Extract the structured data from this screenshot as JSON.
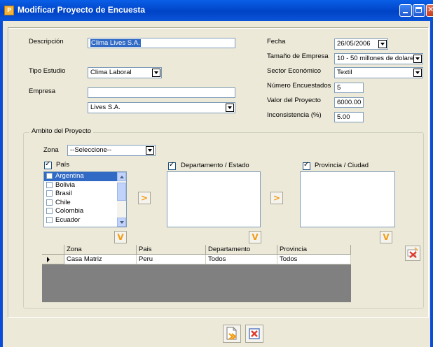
{
  "window": {
    "title": "Modificar Proyecto de Encuesta"
  },
  "form": {
    "descripcion_label": "Descripción",
    "descripcion_value": "Clima Lives S.A.",
    "tipo_estudio_label": "Tipo Estudio",
    "tipo_estudio_value": "Clima Laboral",
    "empresa_label": "Empresa",
    "empresa_search_value": "",
    "empresa_value": "Lives S.A.",
    "fecha_label": "Fecha",
    "fecha_value": "26/05/2006",
    "tamano_label": "Tamaño de Empresa",
    "tamano_value": "10 - 50 millones de dolare",
    "sector_label": "Sector Económico",
    "sector_value": "Textil",
    "num_encuestados_label": "Número Encuestados",
    "num_encuestados_value": "5",
    "valor_label": "Valor del Proyecto",
    "valor_value": "6000.00",
    "inconsistencia_label": "Inconsistencia (%)",
    "inconsistencia_value": "5.00"
  },
  "ambito": {
    "title": "Ambito del Proyecto",
    "zona_label": "Zona",
    "zona_value": "--Seleccione--",
    "pais_label": "País",
    "departamento_label": "Departamento / Estado",
    "provincia_label": "Provincia / Ciudad",
    "paises": [
      "Argentina",
      "Bolivia",
      "Brasil",
      "Chile",
      "Colombia",
      "Ecuador"
    ],
    "add_arrow": ">",
    "down_arrow": "V"
  },
  "grid": {
    "columns": [
      "Zona",
      "Pais",
      "Departamento",
      "Provincia"
    ],
    "rows": [
      {
        "zona": "Casa Matriz",
        "pais": "Peru",
        "departamento": "Todos",
        "provincia": "Todos"
      }
    ]
  },
  "icons": {
    "save": "save-document-icon",
    "cancel": "cancel-icon",
    "delete_row": "delete-row-icon"
  }
}
